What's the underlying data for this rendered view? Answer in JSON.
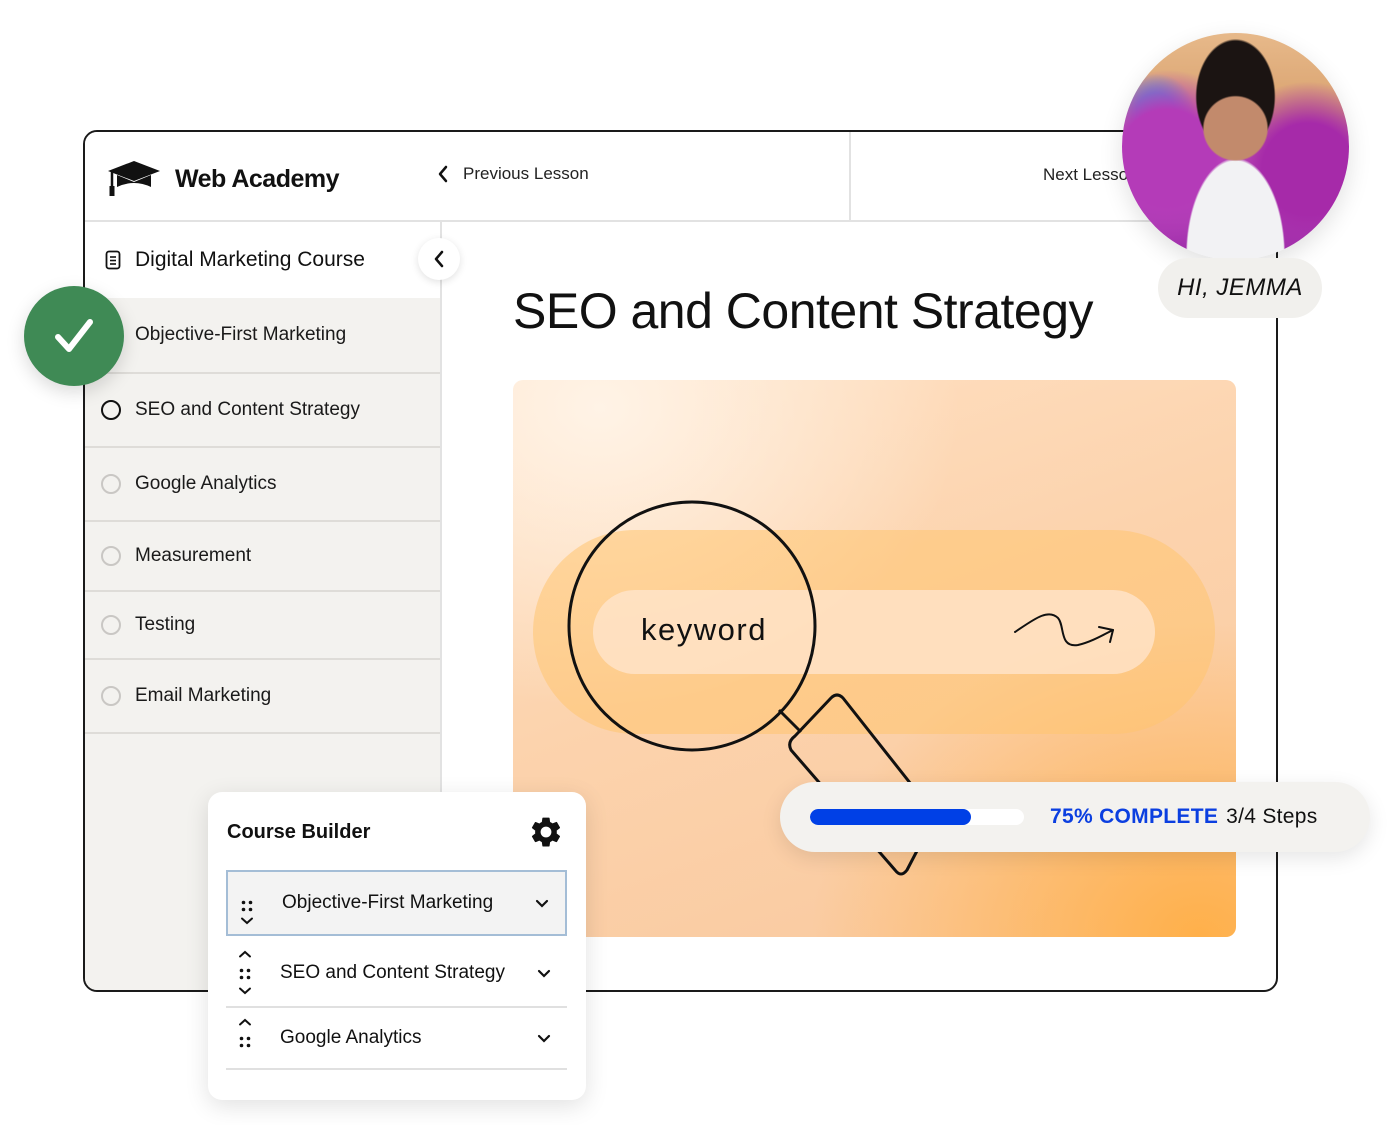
{
  "header": {
    "brand_name": "Web Academy",
    "brand_icon": "graduation-cap-icon",
    "previous_lesson_label": "Previous Lesson",
    "next_lesson_label": "Next Lesson"
  },
  "sidebar": {
    "course_title": "Digital Marketing Course",
    "lessons": [
      {
        "label": "Objective-First Marketing",
        "status": "completed"
      },
      {
        "label": "SEO and Content Strategy",
        "status": "current"
      },
      {
        "label": "Google Analytics",
        "status": "not-started"
      },
      {
        "label": "Measurement",
        "status": "not-started"
      },
      {
        "label": "Testing",
        "status": "not-started"
      },
      {
        "label": "Email Marketing",
        "status": "not-started"
      }
    ]
  },
  "main": {
    "lesson_title": "SEO and Content Strategy",
    "hero": {
      "search_keyword": "keyword",
      "illustration": "magnifying-glass-over-search-bar"
    }
  },
  "user": {
    "greeting": "HI, JEMMA"
  },
  "progress": {
    "percent": 75,
    "complete_label": "75% COMPLETE",
    "steps_label": "3/4 Steps",
    "accent_color": "#0040e6"
  },
  "course_builder": {
    "title": "Course Builder",
    "items": [
      {
        "label": "Objective-First Marketing",
        "selected": true
      },
      {
        "label": "SEO and Content Strategy",
        "selected": false
      },
      {
        "label": "Google Analytics",
        "selected": false
      }
    ]
  },
  "colors": {
    "completed_green": "#3f8a55",
    "sidebar_bg": "#f3f2ef",
    "hero_orange": "#f9c89d"
  }
}
